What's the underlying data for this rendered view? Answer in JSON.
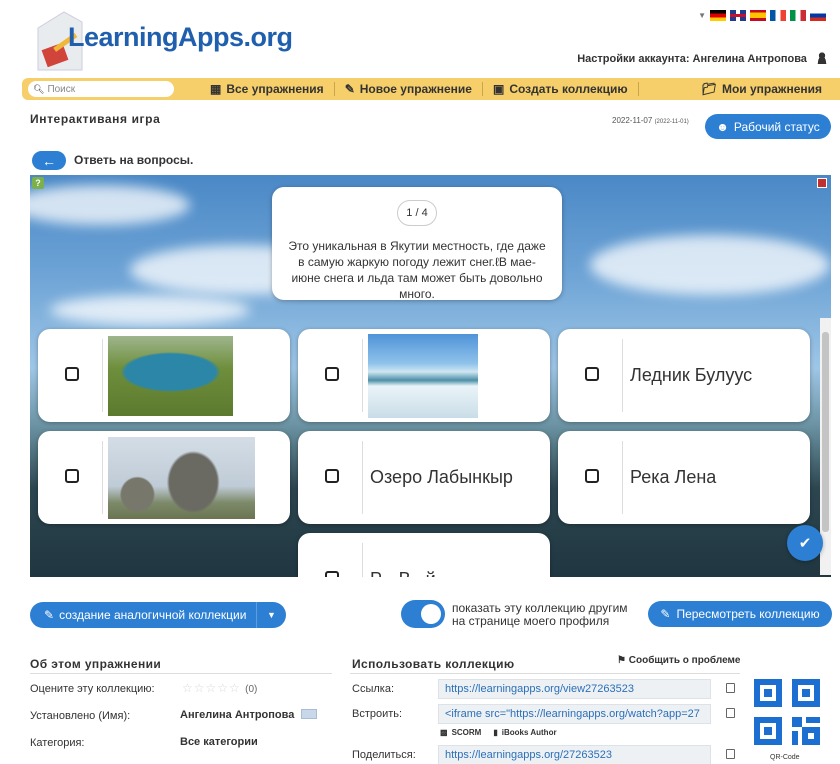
{
  "header": {
    "logo": "LearningApps.org",
    "account_label": "Настройки аккаунта: Ангелина Антропова"
  },
  "nav": {
    "search_placeholder": "Поиск",
    "items": [
      "Все упражнения",
      "Новое упражнение",
      "Создать коллекцию"
    ],
    "my_exercises": "Мои упражнения"
  },
  "page": {
    "title": "Интерактиваня игра",
    "date": "2022-11-07",
    "date_small": "(2022-11-01)",
    "status_button": "Рабочий статус",
    "task_title": "Ответь на вопросы."
  },
  "game": {
    "counter": "1 / 4",
    "question": "Это уникальная в Якутии местность, где даже в самую жаркую погоду лежит снег.",
    "question_tail": "В мае-июне снега и льда там может быть довольно много.",
    "cards": [
      {
        "type": "image",
        "image": "lake-aerial"
      },
      {
        "type": "image",
        "image": "ice-river"
      },
      {
        "type": "text",
        "label": "Ледник Булуус"
      },
      {
        "type": "image",
        "image": "rock-pillars"
      },
      {
        "type": "text",
        "label": "Озеро Лабынкыр"
      },
      {
        "type": "text",
        "label": "Река Лена"
      },
      {
        "type": "text",
        "label": "Р... В...й"
      }
    ]
  },
  "actions": {
    "create_similar": "создание аналогичной коллекции",
    "toggle_label_1": "показать эту коллекцию другим",
    "toggle_label_2": "на странице моего профиля",
    "review": "Пересмотреть коллекцию"
  },
  "about": {
    "heading": "Об этом упражнении",
    "rate_label": "Оцените эту коллекцию:",
    "rating_count": "(0)",
    "author_label": "Установлено (Имя):",
    "author": "Ангелина Антропова",
    "category_label": "Категория:",
    "category": "Все категории"
  },
  "use": {
    "heading": "Использовать коллекцию",
    "report": "Сообщить о проблеме",
    "link_label": "Ссылка:",
    "link": "https://learningapps.org/view27263523",
    "embed_label": "Встроить:",
    "embed": "<iframe src=\"https://learningapps.org/watch?app=27",
    "scorm": "SCORM",
    "ibooks": "iBooks Author",
    "share_label": "Поделиться:",
    "share": "https://learningapps.org/27263523",
    "qr_label": "QR-Code"
  },
  "colors": {
    "accent": "#2c7fd3",
    "nav_bg": "#f6cf6a",
    "logo": "#1f5fae"
  }
}
